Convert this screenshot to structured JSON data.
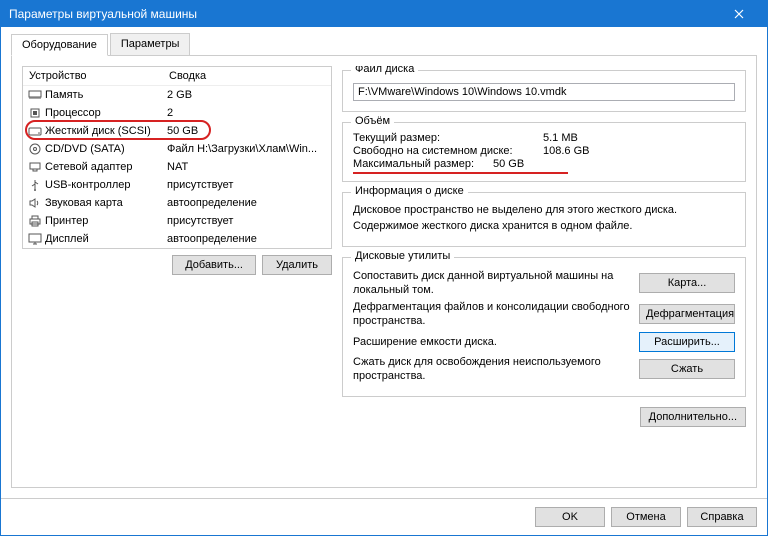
{
  "window": {
    "title": "Параметры виртуальной машины"
  },
  "tabs": {
    "hardware": "Оборудование",
    "options": "Параметры"
  },
  "deviceTable": {
    "headers": {
      "device": "Устройство",
      "summary": "Сводка"
    },
    "rows": [
      {
        "icon": "memory",
        "name": "Память",
        "summary": "2 GB"
      },
      {
        "icon": "cpu",
        "name": "Процессор",
        "summary": "2"
      },
      {
        "icon": "hdd",
        "name": "Жесткий диск (SCSI)",
        "summary": "50 GB",
        "circled": true
      },
      {
        "icon": "cd",
        "name": "CD/DVD (SATA)",
        "summary": "Файл H:\\Загрузки\\Хлам\\Win..."
      },
      {
        "icon": "net",
        "name": "Сетевой адаптер",
        "summary": "NAT"
      },
      {
        "icon": "usb",
        "name": "USB-контроллер",
        "summary": "присутствует"
      },
      {
        "icon": "sound",
        "name": "Звуковая карта",
        "summary": "автоопределение"
      },
      {
        "icon": "printer",
        "name": "Принтер",
        "summary": "присутствует"
      },
      {
        "icon": "display",
        "name": "Дисплей",
        "summary": "автоопределение"
      }
    ]
  },
  "leftButtons": {
    "add": "Добавить...",
    "remove": "Удалить"
  },
  "diskFile": {
    "title": "Файл диска",
    "value": "F:\\VMware\\Windows 10\\Windows 10.vmdk"
  },
  "volume": {
    "title": "Объём",
    "currentLabel": "Текущий размер:",
    "currentVal": "5.1 MB",
    "freeLabel": "Свободно на системном диске:",
    "freeVal": "108.6 GB",
    "maxLabel": "Максимальный размер:",
    "maxVal": "50 GB"
  },
  "diskInfo": {
    "title": "Информация о диске",
    "line1": "Дисковое пространство не выделено для этого жесткого диска.",
    "line2": "Содержимое жесткого диска хранится в одном файле."
  },
  "utilities": {
    "title": "Дисковые утилиты",
    "mapText": "Сопоставить диск данной виртуальной машины на локальный том.",
    "mapBtn": "Карта...",
    "defragText": "Дефрагментация файлов и консолидации свободного пространства.",
    "defragBtn": "Дефрагментация",
    "expandText": "Расширение емкости диска.",
    "expandBtn": "Расширить...",
    "compactText": "Сжать диск для освобождения неиспользуемого пространства.",
    "compactBtn": "Сжать",
    "advancedBtn": "Дополнительно..."
  },
  "footer": {
    "ok": "OK",
    "cancel": "Отмена",
    "help": "Справка"
  }
}
